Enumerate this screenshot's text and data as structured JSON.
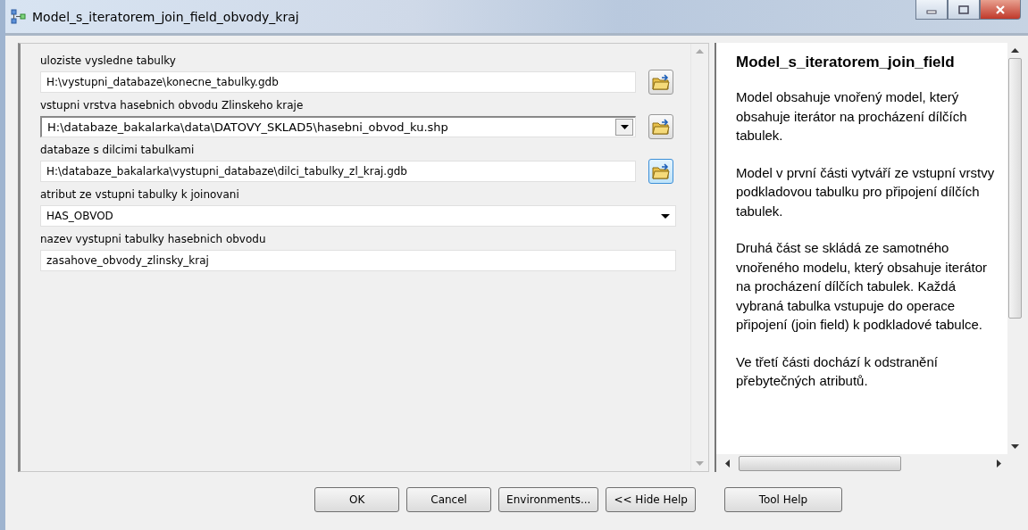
{
  "window": {
    "title": "Model_s_iteratorem_join_field_obvody_kraj"
  },
  "parameters": [
    {
      "kind": "path",
      "label": "uloziste vysledne tabulky",
      "value": "H:\\vystupni_databaze\\konecne_tabulky.gdb"
    },
    {
      "kind": "combo_path",
      "label": "vstupni vrstva hasebnich obvodu Zlinskeho kraje",
      "value": "H:\\databaze_bakalarka\\data\\DATOVY_SKLAD5\\hasebni_obvod_ku.shp"
    },
    {
      "kind": "path",
      "label": "databaze s dilcimi tabulkami",
      "value": "H:\\databaze_bakalarka\\vystupni_databaze\\dilci_tabulky_zl_kraj.gdb"
    },
    {
      "kind": "dropdown",
      "label": "atribut ze vstupni tabulky k joinovani",
      "value": "HAS_OBVOD"
    },
    {
      "kind": "text",
      "label": "nazev vystupni tabulky hasebnich obvodu",
      "value": "zasahove_obvody_zlinsky_kraj"
    }
  ],
  "help": {
    "title": "Model_s_iteratorem_join_field",
    "paragraphs": [
      "Model obsahuje vnořený model, který obsahuje iterátor na procházení dílčích tabulek.",
      "Model v první části vytváří ze vstupní vrstvy podkladovou tabulku pro připojení dílčích tabulek.",
      "Druhá část se skládá ze samotného vnořeného modelu, který obsahuje iterátor na procházení dílčích tabulek. Každá vybraná tabulka vstupuje do operace připojení (join field) k podkladové tabulce.",
      "Ve třetí části dochází k odstranění přebytečných atributů."
    ]
  },
  "buttons": [
    "OK",
    "Cancel",
    "Environments...",
    "<< Hide Help",
    "Tool Help"
  ]
}
